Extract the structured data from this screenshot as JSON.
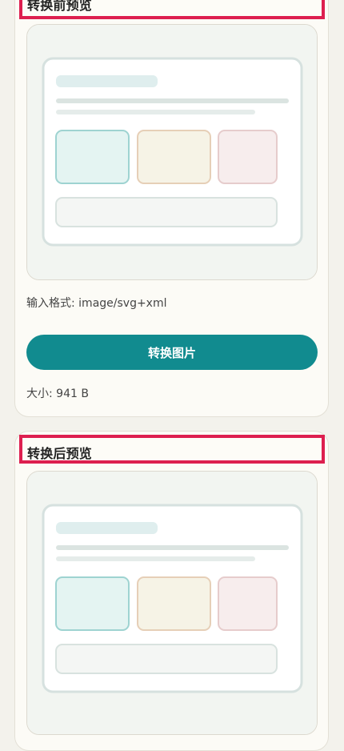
{
  "before": {
    "title": "转换前预览",
    "input_format": "输入格式: image/svg+xml",
    "convert_button": "转换图片",
    "size": "大小: 941 B"
  },
  "after": {
    "title": "转换后预览"
  },
  "colors": {
    "accent": "#118b8f",
    "highlight_border": "#dd1f4f",
    "card_bg": "#fcfbf6",
    "page_bg": "#f3f2ec"
  }
}
